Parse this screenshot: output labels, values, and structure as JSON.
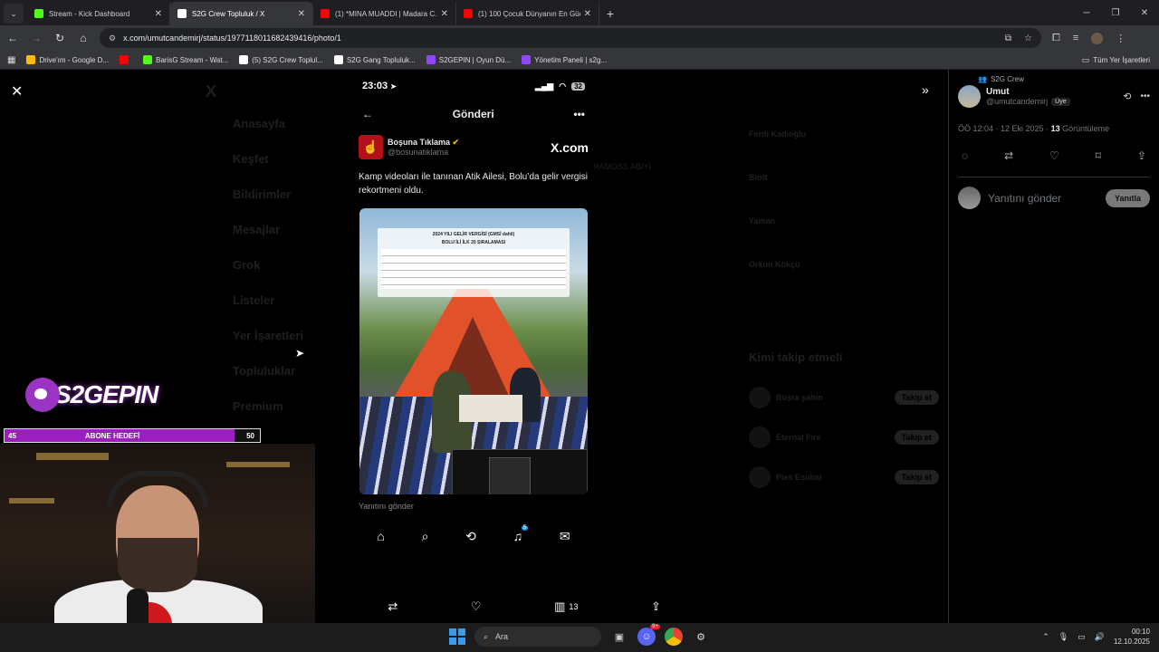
{
  "browser": {
    "tabs": [
      {
        "title": "Stream - Kick Dashboard",
        "icon": "kick-icon",
        "color": "#53fc18"
      },
      {
        "title": "S2G Crew Topluluk / X",
        "icon": "x-icon",
        "color": "#ffffff",
        "active": true
      },
      {
        "title": "(1) *MINA MUADDI | Madara C...",
        "icon": "youtube-icon",
        "color": "#ff0000"
      },
      {
        "title": "(1) 100 Çocuk Dünyanın En Güç...",
        "icon": "youtube-icon",
        "color": "#ff0000"
      }
    ],
    "new_tab": "+",
    "url": "x.com/umutcandemirj/status/1977118011682439416/photo/1",
    "bookmarks": [
      {
        "label": "Drive'ım - Google D...",
        "icon": "drive-icon",
        "color": "#fbbc04"
      },
      {
        "label": "",
        "icon": "youtube-icon",
        "color": "#ff0000"
      },
      {
        "label": "BarisG Stream - Wat...",
        "icon": "kick-icon",
        "color": "#53fc18"
      },
      {
        "label": "(5) S2G Crew Toplul...",
        "icon": "x-icon",
        "color": "#ffffff"
      },
      {
        "label": "S2G Gang Topluluk...",
        "icon": "x-icon",
        "color": "#ffffff"
      },
      {
        "label": "S2GEPIN | Oyun Dü...",
        "icon": "twitch-icon",
        "color": "#9146ff"
      },
      {
        "label": "Yönetim Paneli | s2g...",
        "icon": "twitch-icon",
        "color": "#9146ff"
      }
    ],
    "all_bookmarks": "Tüm Yer İşaretleri"
  },
  "background_nav": [
    "Anasayfa",
    "Keşfet",
    "Bildirimler",
    "Mesajlar",
    "Grok",
    "Listeler",
    "Yer İşaretleri",
    "Topluluklar",
    "Premium"
  ],
  "background_right": {
    "who_to_follow": "Kimi takip etmeli",
    "people": [
      "Büşra şahin",
      "Eternal Fire",
      "Pies Esubal"
    ],
    "follow": "Takip et",
    "items": [
      "Ferdi Kadıoğlu",
      "Bioft",
      "Yaman",
      "Orkun Kökçü"
    ],
    "center_text": "RAMOSS ABIYI"
  },
  "phone": {
    "time": "23:03",
    "battery": "32",
    "header_title": "Gönderi",
    "author_name": "Boşuna Tıklama",
    "author_handle": "@bosunatiklama",
    "brand": "X.com",
    "post_text": "Kamp videoları ile tanınan Atik Ailesi, Bolu’da gelir vergisi rekortmeni oldu.",
    "doc_title": "2024 YILI GELİR VERGİSİ (GMSİ dahil)",
    "doc_subtitle": "BOLU İLİ İLK 20 SIRALAMASI",
    "reply_placeholder": "Yanıtını gönder",
    "notif_count": "5"
  },
  "media_actions": {
    "views": "13"
  },
  "tweet_panel": {
    "community": "S2G Crew",
    "name": "Umut",
    "handle": "@umutcandemirj",
    "badge": "Üye",
    "time": "ÖÖ 12:04 · 12 Eki 2025 · ",
    "views": "13",
    "views_label": " Görüntüleme",
    "reply_placeholder": "Yanıtını gönder",
    "reply_button": "Yanıtla"
  },
  "stream_overlay": {
    "logo_text": "S2GEPIN",
    "goal_label": "ABONE HEDEFİ",
    "goal_current": "45",
    "goal_target": "50",
    "goal_progress": 0.9
  },
  "taskbar": {
    "search_label": "Ara",
    "discord_badge": "9+",
    "time": "00:10",
    "date": "12.10.2025"
  }
}
